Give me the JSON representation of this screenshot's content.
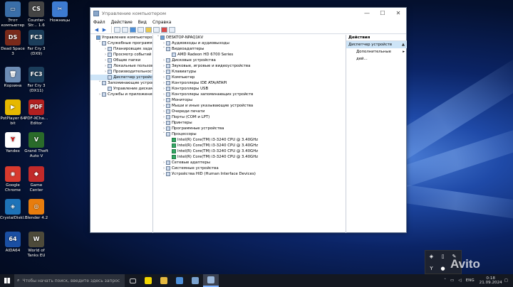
{
  "desktop": {
    "icons": [
      {
        "label": "Этот компьютер",
        "color": "#3a6ea8",
        "glyph": "▭"
      },
      {
        "label": "Counter-Str... 1.6",
        "color": "#444",
        "glyph": "CS"
      },
      {
        "label": "Ножницы",
        "color": "#3d7bd1",
        "glyph": "✂"
      },
      {
        "label": "Dead Space 3",
        "color": "#7a2a1a",
        "glyph": "DS"
      },
      {
        "label": "Far Cry 3 (DX9)",
        "color": "#1b3d5a",
        "glyph": "FC3"
      },
      {
        "label": "Корзина",
        "color": "#6d8db5",
        "glyph": "🗑"
      },
      {
        "label": "Far Cry 3 (DX11)",
        "color": "#1b3d5a",
        "glyph": "FC3"
      },
      {
        "label": "PotPlayer 64 bit",
        "color": "#e6b800",
        "glyph": "▶"
      },
      {
        "label": "PDF-XCha... Editor",
        "color": "#b32020",
        "glyph": "PDF"
      },
      {
        "label": "Yandex",
        "color": "#ffffff",
        "glyph": "Y"
      },
      {
        "label": "Grand Theft Auto V",
        "color": "#2a6b2a",
        "glyph": "V"
      },
      {
        "label": "Google Chrome",
        "color": "#d83a2e",
        "glyph": "◉"
      },
      {
        "label": "Game Center",
        "color": "#c22a2a",
        "glyph": "◆"
      },
      {
        "label": "CrystalDiskl...",
        "color": "#1e73b8",
        "glyph": "◈"
      },
      {
        "label": "Blender 4.2",
        "color": "#e87d0d",
        "glyph": "◎"
      },
      {
        "label": "AIDA64",
        "color": "#1a4fa3",
        "glyph": "64"
      },
      {
        "label": "World of Tanks EU",
        "color": "#4d4a3a",
        "glyph": "W"
      }
    ]
  },
  "window": {
    "title": "Управление компьютером",
    "controls": [
      "—",
      "☐",
      "✕"
    ],
    "menu": [
      "Файл",
      "Действие",
      "Вид",
      "Справка"
    ],
    "left_tree": [
      {
        "text": "Управление компьютером (л",
        "indent": 0,
        "tw": "",
        "icon": "pc"
      },
      {
        "text": "Служебные программы",
        "indent": 1,
        "tw": "˅",
        "icon": ""
      },
      {
        "text": "Планировщик заданий",
        "indent": 2,
        "tw": "›",
        "icon": ""
      },
      {
        "text": "Просмотр событий",
        "indent": 2,
        "tw": "›",
        "icon": ""
      },
      {
        "text": "Общие папки",
        "indent": 2,
        "tw": "›",
        "icon": ""
      },
      {
        "text": "Локальные пользовате",
        "indent": 2,
        "tw": "›",
        "icon": ""
      },
      {
        "text": "Производительность",
        "indent": 2,
        "tw": "›",
        "icon": ""
      },
      {
        "text": "Диспетчер устройств",
        "indent": 2,
        "tw": "",
        "icon": "",
        "selected": true
      },
      {
        "text": "Запоминающие устройст",
        "indent": 1,
        "tw": "˅",
        "icon": ""
      },
      {
        "text": "Управление дисками",
        "indent": 2,
        "tw": "",
        "icon": ""
      },
      {
        "text": "Службы и приложения",
        "indent": 1,
        "tw": "›",
        "icon": ""
      }
    ],
    "device_tree": [
      {
        "text": "DESKTOP-NPAQ1KV",
        "indent": 0,
        "tw": "˅",
        "icon": "pc"
      },
      {
        "text": "Аудиовходы и аудиовыходы",
        "indent": 1,
        "tw": "›",
        "icon": ""
      },
      {
        "text": "Видеоадаптеры",
        "indent": 1,
        "tw": "˅",
        "icon": ""
      },
      {
        "text": "AMD Radeon HD 6700 Series",
        "indent": 2,
        "tw": "",
        "icon": ""
      },
      {
        "text": "Дисковые устройства",
        "indent": 1,
        "tw": "›",
        "icon": ""
      },
      {
        "text": "Звуковые, игровые и видеоустройства",
        "indent": 1,
        "tw": "›",
        "icon": ""
      },
      {
        "text": "Клавиатуры",
        "indent": 1,
        "tw": "›",
        "icon": ""
      },
      {
        "text": "Компьютер",
        "indent": 1,
        "tw": "›",
        "icon": ""
      },
      {
        "text": "Контроллеры IDE ATA/ATAPI",
        "indent": 1,
        "tw": "›",
        "icon": ""
      },
      {
        "text": "Контроллеры USB",
        "indent": 1,
        "tw": "›",
        "icon": ""
      },
      {
        "text": "Контроллеры запоминающих устройств",
        "indent": 1,
        "tw": "›",
        "icon": ""
      },
      {
        "text": "Мониторы",
        "indent": 1,
        "tw": "›",
        "icon": ""
      },
      {
        "text": "Мыши и иные указывающие устройства",
        "indent": 1,
        "tw": "›",
        "icon": ""
      },
      {
        "text": "Очереди печати",
        "indent": 1,
        "tw": "›",
        "icon": ""
      },
      {
        "text": "Порты (COM и LPT)",
        "indent": 1,
        "tw": "›",
        "icon": ""
      },
      {
        "text": "Принтеры",
        "indent": 1,
        "tw": "›",
        "icon": ""
      },
      {
        "text": "Программные устройства",
        "indent": 1,
        "tw": "›",
        "icon": ""
      },
      {
        "text": "Процессоры",
        "indent": 1,
        "tw": "˅",
        "icon": ""
      },
      {
        "text": "Intel(R) Core(TM) i3-3240 CPU @ 3.40GHz",
        "indent": 2,
        "tw": "",
        "icon": "cpu"
      },
      {
        "text": "Intel(R) Core(TM) i3-3240 CPU @ 3.40GHz",
        "indent": 2,
        "tw": "",
        "icon": "cpu"
      },
      {
        "text": "Intel(R) Core(TM) i3-3240 CPU @ 3.40GHz",
        "indent": 2,
        "tw": "",
        "icon": "cpu"
      },
      {
        "text": "Intel(R) Core(TM) i3-3240 CPU @ 3.40GHz",
        "indent": 2,
        "tw": "",
        "icon": "cpu"
      },
      {
        "text": "Сетевые адаптеры",
        "indent": 1,
        "tw": "›",
        "icon": ""
      },
      {
        "text": "Системные устройства",
        "indent": 1,
        "tw": "›",
        "icon": ""
      },
      {
        "text": "Устройства HID (Human Interface Devices)",
        "indent": 1,
        "tw": "›",
        "icon": ""
      }
    ],
    "actions": {
      "header": "Действия",
      "group": "Диспетчер устройств",
      "group_arrow": "▲",
      "item": "Дополнительные дей...",
      "item_arrow": "▸"
    }
  },
  "taskbar": {
    "search_placeholder": "Чтобы начать поиск, введите здесь запрос",
    "search_icon": "⌕",
    "lang": "ENG",
    "time": "0:18",
    "date": "21.09.2024"
  },
  "watermark": "Avito"
}
